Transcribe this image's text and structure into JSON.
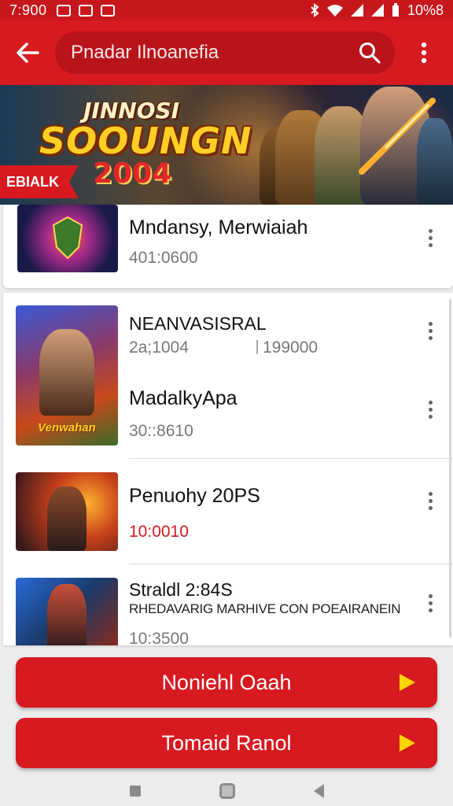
{
  "status_bar": {
    "time": "7:900",
    "clock": "10%8",
    "icons": [
      "notification-icon",
      "bluetooth-icon",
      "wifi-icon",
      "signal-icon",
      "battery-icon"
    ]
  },
  "app_bar": {
    "back_icon": "arrow-left-icon",
    "search_value": "Pnadar Ilnoanefia",
    "search_icon": "search-icon",
    "menu_icon": "more-vertical-icon"
  },
  "banner": {
    "title_small": "JINNOSI",
    "title_big": "SOOUNGN",
    "year": "2004",
    "ribbon": "EBIALK"
  },
  "featured_item": {
    "title": "Mndansy, Merwiaiah",
    "meta": "401:0600"
  },
  "list_items": [
    {
      "title": "NEANVASISRAL",
      "meta": "2a;1004",
      "meta2": "199000",
      "thumb_text": "Venwahan"
    },
    {
      "title": "MadalkyApa",
      "meta": "30::8610"
    },
    {
      "title": "Penuohy 20PS",
      "meta": "10:0010",
      "meta_color": "#d71920"
    },
    {
      "title": "Straldl 2:84S",
      "description": "RHEDAVARIG MARHIVE CON POEAIRANEIN",
      "meta": "10:3500"
    }
  ],
  "buttons": {
    "primary": "Noniehl Oaah",
    "secondary": "Tomaid Ranol",
    "play_icon": "play-icon"
  },
  "colors": {
    "accent": "#d71920",
    "play": "#ffd400"
  }
}
